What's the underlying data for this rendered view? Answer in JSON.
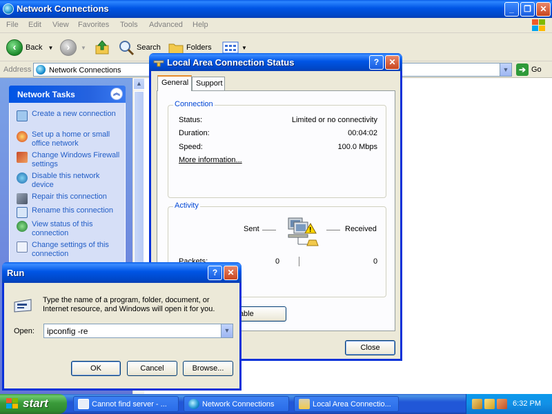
{
  "explorer": {
    "title": "Network Connections",
    "menu": [
      "File",
      "Edit",
      "View",
      "Favorites",
      "Tools",
      "Advanced",
      "Help"
    ],
    "toolbar": {
      "back": "Back",
      "search": "Search",
      "folders": "Folders"
    },
    "address": {
      "label": "Address",
      "value": "Network Connections",
      "go": "Go"
    },
    "tasks": {
      "heading": "Network Tasks",
      "items": [
        {
          "label": "Create a new connection",
          "icon": "new-connection-icon"
        },
        {
          "label": "Set up a home or small office network",
          "icon": "home-network-icon"
        },
        {
          "label": "Change Windows Firewall settings",
          "icon": "firewall-icon"
        },
        {
          "label": "Disable this network device",
          "icon": "disable-device-icon"
        },
        {
          "label": "Repair this connection",
          "icon": "repair-icon"
        },
        {
          "label": "Rename this connection",
          "icon": "rename-icon"
        },
        {
          "label": "View status of this connection",
          "icon": "status-icon"
        },
        {
          "label": "Change settings of this connection",
          "icon": "settings-icon"
        }
      ]
    }
  },
  "status_dialog": {
    "title": "Local Area Connection Status",
    "tabs": [
      "General",
      "Support"
    ],
    "connection": {
      "heading": "Connection",
      "status_label": "Status:",
      "status_value": "Limited or no connectivity",
      "duration_label": "Duration:",
      "duration_value": "00:04:02",
      "speed_label": "Speed:",
      "speed_value": "100.0 Mbps",
      "more_info": "More information..."
    },
    "activity": {
      "heading": "Activity",
      "sent_label": "Sent",
      "received_label": "Received",
      "packets_label": "Packets:",
      "packets_sent": "0",
      "packets_received": "0"
    },
    "disable_button": "isable",
    "close_button": "Close"
  },
  "run_dialog": {
    "title": "Run",
    "message": "Type the name of a program, folder, document, or Internet resource, and Windows will open it for you.",
    "open_label": "Open:",
    "open_value": "ipconfig -re",
    "ok": "OK",
    "cancel": "Cancel",
    "browse": "Browse..."
  },
  "taskbar": {
    "start": "start",
    "tasks": [
      "Cannot find server - ...",
      "Network Connections",
      "Local Area Connectio..."
    ],
    "clock": "6:32 PM"
  },
  "colors": {
    "xp_blue": "#0055e5",
    "task_link": "#215dc6",
    "group_title": "#0046d5",
    "start_green": "#3a9a3a"
  }
}
